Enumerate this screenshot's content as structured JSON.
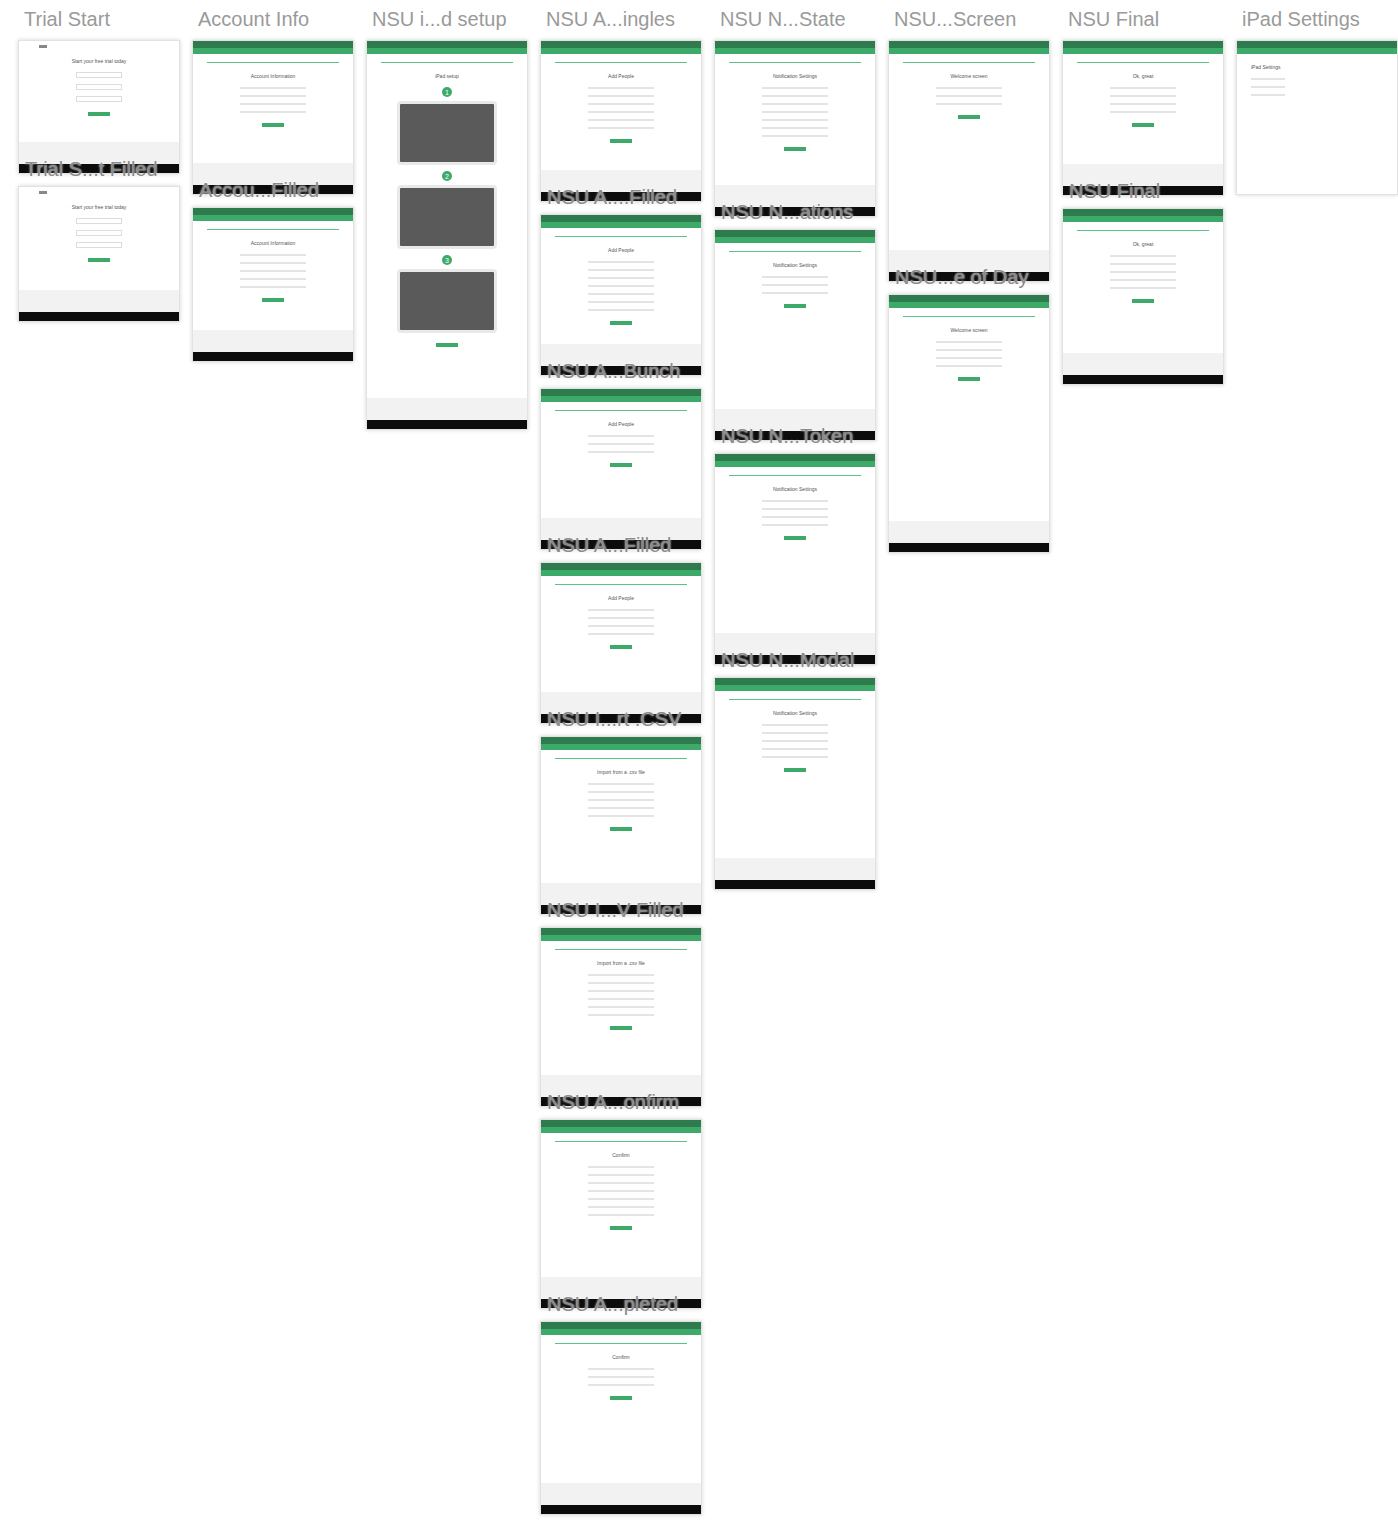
{
  "canvas": {
    "columns": [
      {
        "artboards": [
          {
            "title": "Trial Start",
            "kind": "trial",
            "heading": "Start your free trial today"
          },
          {
            "title": "Trial S...t Filled",
            "kind": "trial",
            "heading": "Start your free trial today"
          }
        ]
      },
      {
        "artboards": [
          {
            "title": "Account Info",
            "kind": "app",
            "heading": "Account Information"
          },
          {
            "title": "Accou...Filled",
            "kind": "app",
            "heading": "Account Information"
          }
        ]
      },
      {
        "artboards": [
          {
            "title": "NSU i...d setup",
            "kind": "setup",
            "heading": "iPad setup",
            "steps": [
              "1",
              "2",
              "3"
            ]
          }
        ]
      },
      {
        "artboards": [
          {
            "title": "NSU A...ingles",
            "kind": "app",
            "heading": "Add People"
          },
          {
            "title": "NSU A....Filled",
            "kind": "app",
            "heading": "Add People"
          },
          {
            "title": "NSU A...Bunch",
            "kind": "app",
            "heading": "Add People"
          },
          {
            "title": "NSU A...Filled",
            "kind": "app",
            "heading": "Add People"
          },
          {
            "title": "NSU I...rt .CSV",
            "kind": "app",
            "heading": "Import from a .csv file"
          },
          {
            "title": "NSU I...V Filled",
            "kind": "app",
            "heading": "Import from a .csv file"
          },
          {
            "title": "NSU A...onfirm",
            "kind": "app",
            "heading": "Confirm"
          },
          {
            "title": "NSU A...pleted",
            "kind": "app",
            "heading": "Confirm"
          }
        ]
      },
      {
        "artboards": [
          {
            "title": "NSU N...State",
            "kind": "app",
            "heading": "Notification Settings"
          },
          {
            "title": "NSU N...ations",
            "kind": "app",
            "heading": "Notification Settings"
          },
          {
            "title": "NSU N...Token",
            "kind": "app",
            "heading": "Notification Settings"
          },
          {
            "title": "NSU N...Modal",
            "kind": "app",
            "heading": "Notification Settings"
          }
        ]
      },
      {
        "artboards": [
          {
            "title": "NSU...Screen",
            "kind": "app",
            "heading": "Welcome screen"
          },
          {
            "title": "NSU...e of Day",
            "kind": "app",
            "heading": "Welcome screen"
          }
        ]
      },
      {
        "artboards": [
          {
            "title": "NSU Final",
            "kind": "app",
            "heading": "Ok, great"
          },
          {
            "title": "NSU Final",
            "kind": "app",
            "heading": "Ok, great"
          }
        ]
      },
      {
        "artboards": [
          {
            "title": "iPad Settings",
            "kind": "ipad",
            "heading": "iPad Settings"
          }
        ]
      }
    ]
  }
}
